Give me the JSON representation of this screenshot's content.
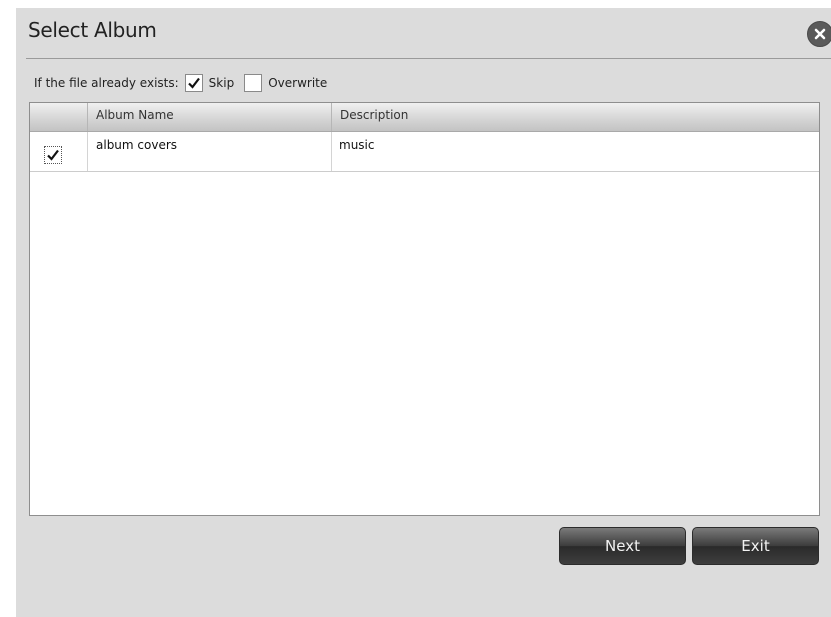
{
  "dialog": {
    "title": "Select Album",
    "close_icon": "close-icon"
  },
  "options": {
    "prompt": "If the file already exists:",
    "skip_label": "Skip",
    "skip_checked": true,
    "overwrite_label": "Overwrite",
    "overwrite_checked": false
  },
  "table": {
    "columns": [
      "",
      "Album Name",
      "Description"
    ],
    "rows": [
      {
        "selected": true,
        "album_name": "album covers",
        "description": "music"
      }
    ]
  },
  "buttons": {
    "next_label": "Next",
    "exit_label": "Exit"
  }
}
